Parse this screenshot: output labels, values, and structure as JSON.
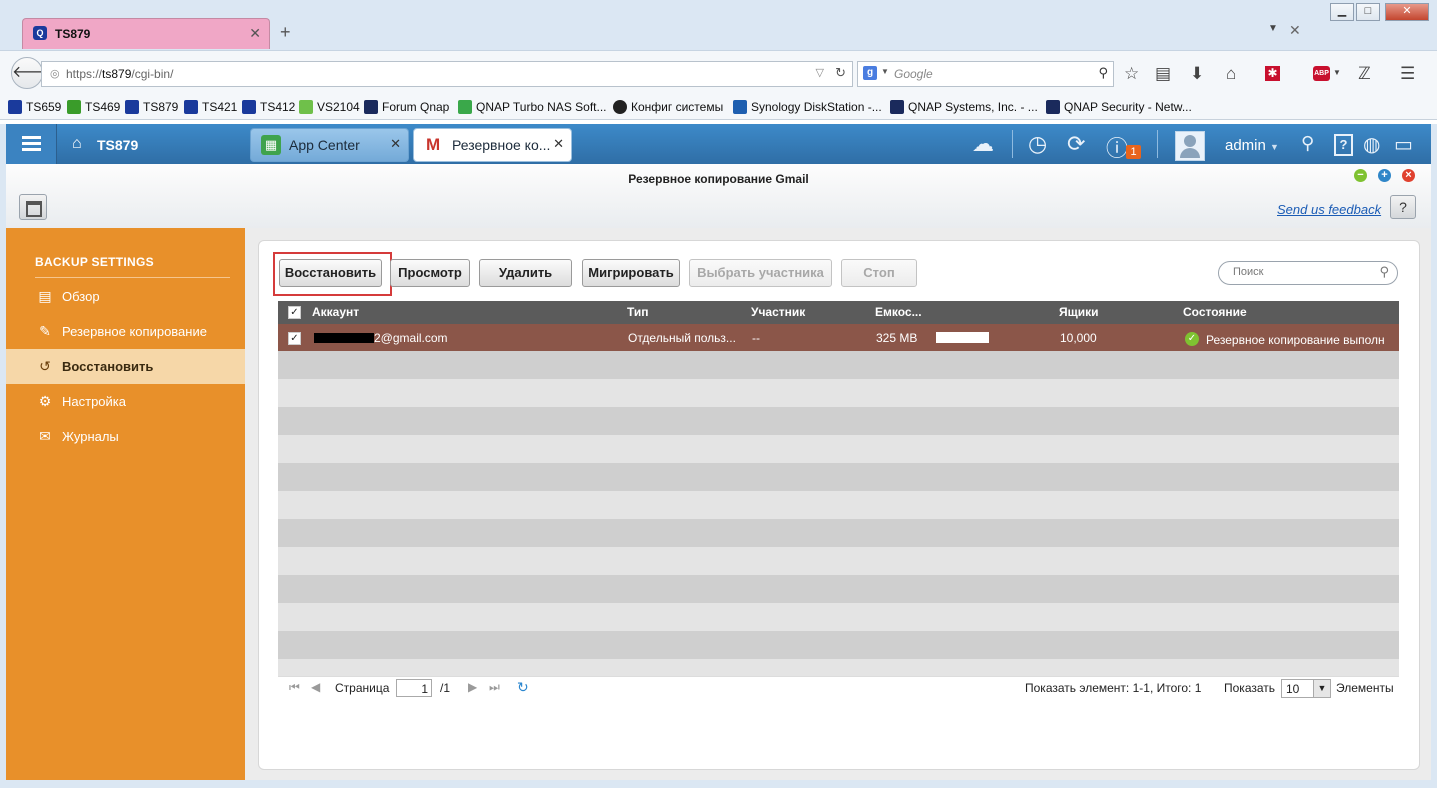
{
  "browser": {
    "tab_title": "TS879",
    "url_prefix": "https://",
    "url_host": "ts879",
    "url_path": "/cgi-bin/",
    "search_placeholder": "Google",
    "bookmarks": [
      {
        "label": "TS659",
        "color": "#1a3a9c"
      },
      {
        "label": "TS469",
        "color": "#3a9c2a"
      },
      {
        "label": "TS879",
        "color": "#1a3a9c"
      },
      {
        "label": "TS421",
        "color": "#1a3a9c"
      },
      {
        "label": "TS412",
        "color": "#1a3a9c"
      },
      {
        "label": "VS2104",
        "color": "#6fc04a"
      },
      {
        "label": "Forum Qnap",
        "color": "#1a2a5c"
      },
      {
        "label": "QNAP Turbo NAS Soft...",
        "color": "#3aa84a"
      },
      {
        "label": "Конфиг системы",
        "color": "#222222"
      },
      {
        "label": "Synology DiskStation -...",
        "color": "#1e5fb0"
      },
      {
        "label": "QNAP Systems, Inc. - ...",
        "color": "#1a2a5c"
      },
      {
        "label": "QNAP Security - Netw...",
        "color": "#1a2a5c"
      }
    ]
  },
  "qts": {
    "host_label": "TS879",
    "tabs": [
      {
        "label": "App Center"
      },
      {
        "label": "Резервное ко..."
      }
    ],
    "notification_count": "1",
    "user": "admin",
    "window_title": "Резервное копирование Gmail",
    "feedback": "Send us feedback",
    "help": "?"
  },
  "sidebar": {
    "section_title": "BACKUP SETTINGS",
    "items": [
      {
        "label": "Обзор",
        "icon": "overview-icon",
        "active": false
      },
      {
        "label": "Резервное копирование",
        "icon": "backup-icon",
        "active": false
      },
      {
        "label": "Восстановить",
        "icon": "restore-icon",
        "active": true
      },
      {
        "label": "Настройка",
        "icon": "gear-icon",
        "active": false
      },
      {
        "label": "Журналы",
        "icon": "logs-icon",
        "active": false
      }
    ]
  },
  "toolbar": {
    "restore": "Восстановить",
    "view": "Просмотр",
    "delete": "Удалить",
    "migrate": "Мигрировать",
    "select_member": "Выбрать участника",
    "stop": "Стоп",
    "search_placeholder": "Поиск"
  },
  "grid": {
    "columns": [
      "Аккаунт",
      "Тип",
      "Участник",
      "Емкос...",
      "Ящики",
      "Состояние"
    ],
    "rows": [
      {
        "account": "2@gmail.com",
        "type": "Отдельный польз...",
        "member": "--",
        "capacity": "325 MB",
        "boxes": "10,000",
        "status": "Резервное копирование выполн"
      }
    ]
  },
  "pager": {
    "page_label": "Страница",
    "page": "1",
    "total_pages": "/1",
    "summary": "Показать элемент: 1-1, Итого: 1",
    "show_label": "Показать",
    "per_page": "10",
    "items_label": "Элементы"
  },
  "colors": {
    "sidebar": "#e8902a",
    "header": "#3a7fbe",
    "grid_header": "#5b5b5b",
    "selected_row": "#8b5649",
    "highlight": "#d53b3b"
  }
}
